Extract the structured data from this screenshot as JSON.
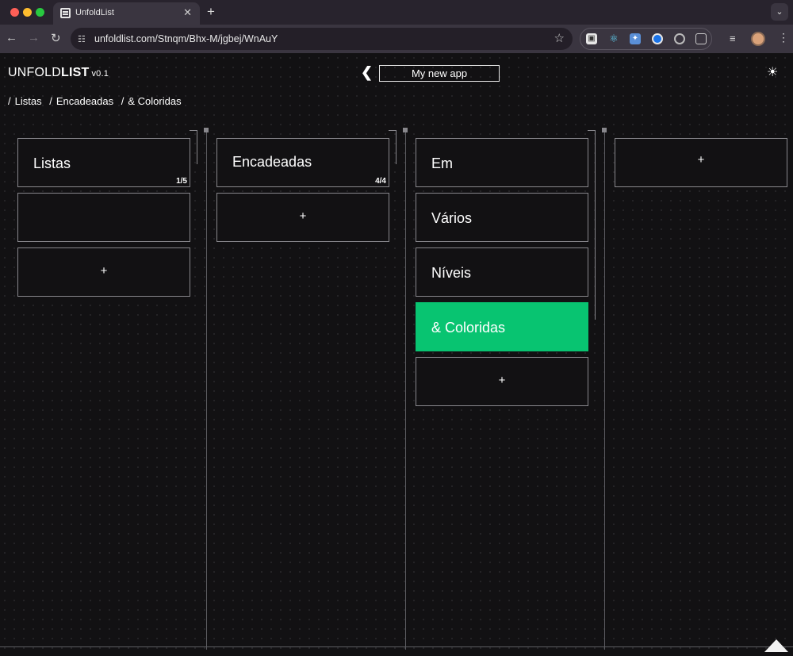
{
  "browser": {
    "tab_title": "UnfoldList",
    "url": "unfoldlist.com/Stnqm/Bhx-M/jgbej/WnAuY"
  },
  "header": {
    "brand_left": "UNFOLD",
    "brand_right": "LIST",
    "version": "v0.1",
    "app_name": "My new app"
  },
  "breadcrumb": [
    "Listas",
    "Encadeadas",
    "& Coloridas"
  ],
  "columns": [
    {
      "items": [
        {
          "label": "Listas",
          "count": "1/5"
        },
        {
          "label": ""
        },
        {
          "label": "+"
        }
      ]
    },
    {
      "items": [
        {
          "label": "Encadeadas",
          "count": "4/4"
        },
        {
          "label": "+"
        }
      ]
    },
    {
      "items": [
        {
          "label": "Em"
        },
        {
          "label": "Vários"
        },
        {
          "label": "Níveis"
        },
        {
          "label": "& Coloridas"
        },
        {
          "label": "+"
        }
      ]
    },
    {
      "items": [
        {
          "label": "+"
        }
      ]
    }
  ],
  "colors": {
    "active": "#08c471",
    "background": "#121113",
    "border": "#88878c"
  }
}
